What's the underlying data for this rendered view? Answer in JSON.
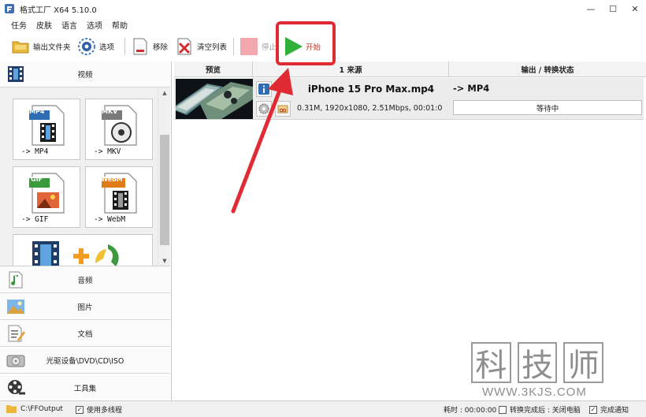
{
  "window": {
    "title": "格式工厂 X64 5.10.0",
    "minimize": "—",
    "maximize": "☐",
    "close": "✕"
  },
  "menu": [
    "任务",
    "皮肤",
    "语言",
    "选项",
    "帮助"
  ],
  "toolbar": {
    "output_folder": "输出文件夹",
    "options": "选项",
    "remove": "移除",
    "clear_list": "清空列表",
    "stop": "停止",
    "start": "开始"
  },
  "categories": {
    "video": "视频",
    "audio": "音频",
    "image": "图片",
    "document": "文档",
    "disc": "光驱设备\\DVD\\CD\\ISO",
    "tools": "工具集"
  },
  "video_tiles": [
    {
      "badge": "MP4",
      "label": "-> MP4",
      "color": "#2f6db3"
    },
    {
      "badge": "MKV",
      "label": "-> MKV",
      "color": "#7a7a7a"
    },
    {
      "badge": "GIF",
      "label": "-> GIF",
      "color": "#3a9a3e"
    },
    {
      "badge": "WebM",
      "label": "-> WebM",
      "color": "#e07b1a"
    }
  ],
  "table": {
    "headers": {
      "preview": "预览",
      "source": "1 来源",
      "output": "输出 / 转换状态"
    },
    "rows": [
      {
        "filename": "iPhone 15 Pro Max.mp4",
        "info": "0.31M, 1920x1080, 2.51Mbps, 00:01:0",
        "output_format": "-> MP4",
        "status": "等待中"
      }
    ]
  },
  "statusbar": {
    "output_path": "C:\\FFOutput",
    "multithread": "使用多线程",
    "elapsed": "耗时 : 00:00:00",
    "after_convert": "转换完成后 : 关闭电脑",
    "notify": "完成通知",
    "multithread_checked": true,
    "after_convert_checked": false,
    "notify_checked": true
  },
  "watermark": {
    "chars": [
      "科",
      "技",
      "师"
    ],
    "url": "WWW.3KJS.COM"
  },
  "colors": {
    "annotation": "#e02b34",
    "start_green": "#2fb03a"
  }
}
